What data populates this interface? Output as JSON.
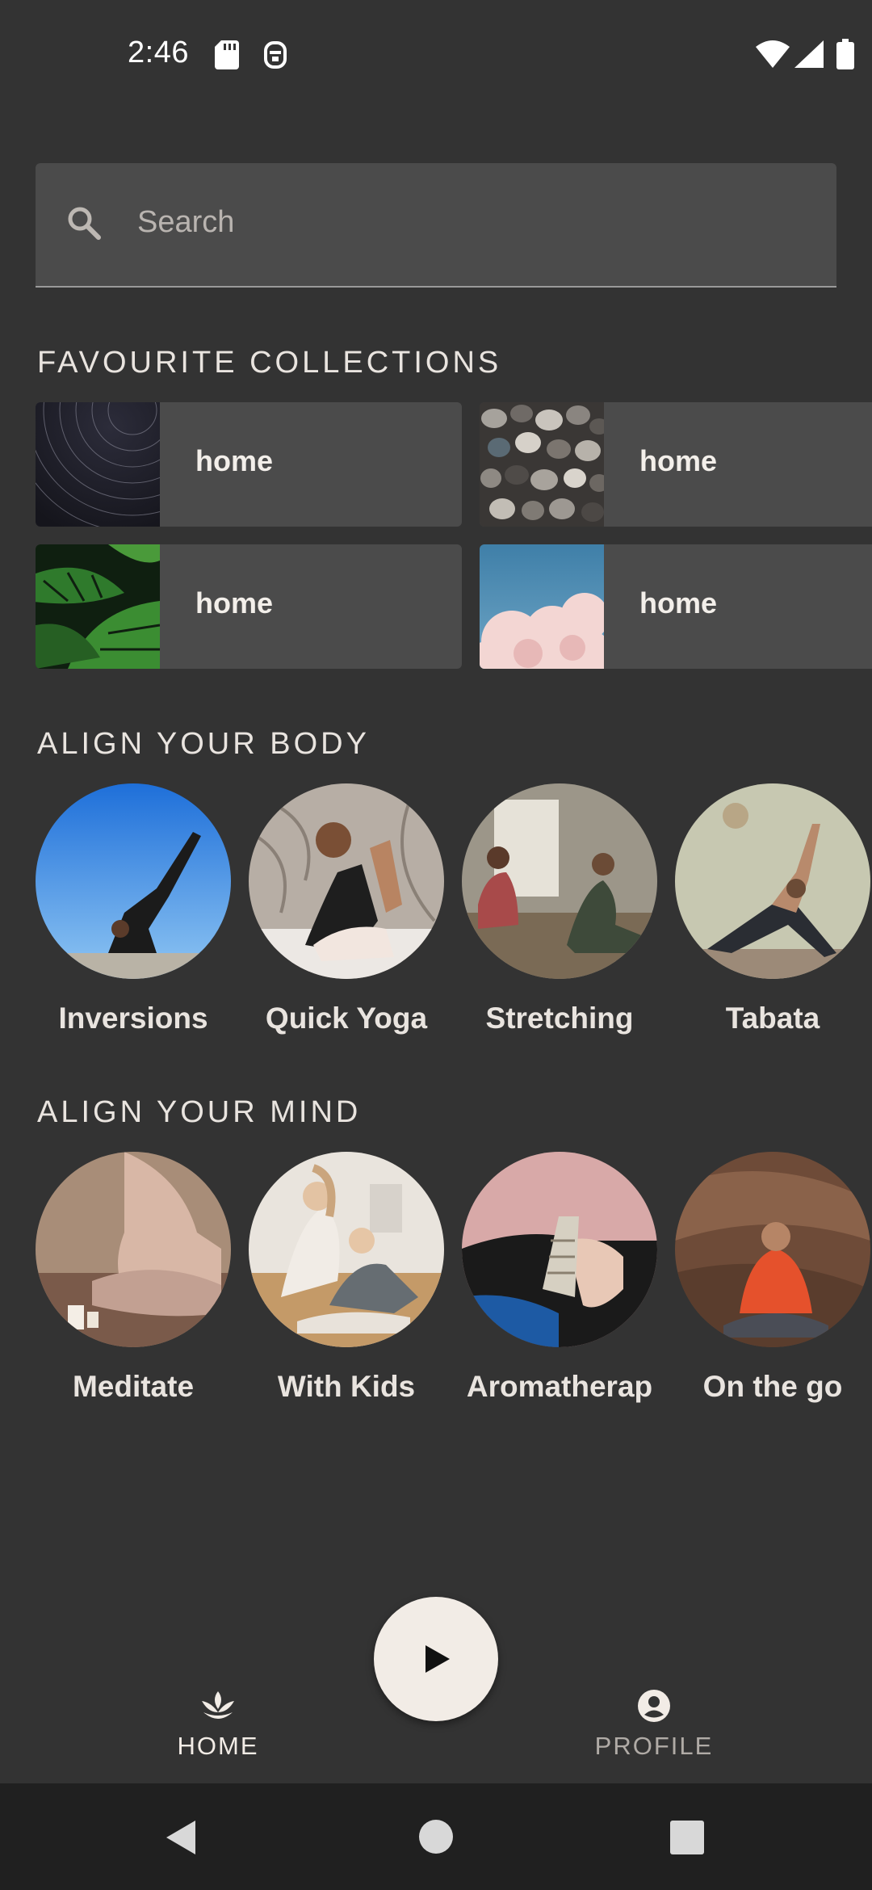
{
  "status_bar": {
    "time": "2:46"
  },
  "search": {
    "placeholder": "Search"
  },
  "favourites": {
    "title": "FAVOURITE COLLECTIONS",
    "items": [
      {
        "label": "home",
        "thumb": "star-trails"
      },
      {
        "label": "home",
        "thumb": "pebbles"
      },
      {
        "label": "home",
        "thumb": "monstera-leaves"
      },
      {
        "label": "home",
        "thumb": "clouds"
      }
    ]
  },
  "body": {
    "title": "ALIGN YOUR BODY",
    "items": [
      {
        "label": "Inversions"
      },
      {
        "label": "Quick Yoga"
      },
      {
        "label": "Stretching"
      },
      {
        "label": "Tabata"
      }
    ]
  },
  "mind": {
    "title": "ALIGN YOUR MIND",
    "items": [
      {
        "label": "Meditate"
      },
      {
        "label": "With Kids"
      },
      {
        "label": "Aromatherap"
      },
      {
        "label": "On the go"
      }
    ]
  },
  "bottom_nav": {
    "home_label": "HOME",
    "profile_label": "PROFILE"
  },
  "colors": {
    "background": "#333333",
    "surface": "#4b4b4b",
    "accent": "#f2ece6"
  }
}
